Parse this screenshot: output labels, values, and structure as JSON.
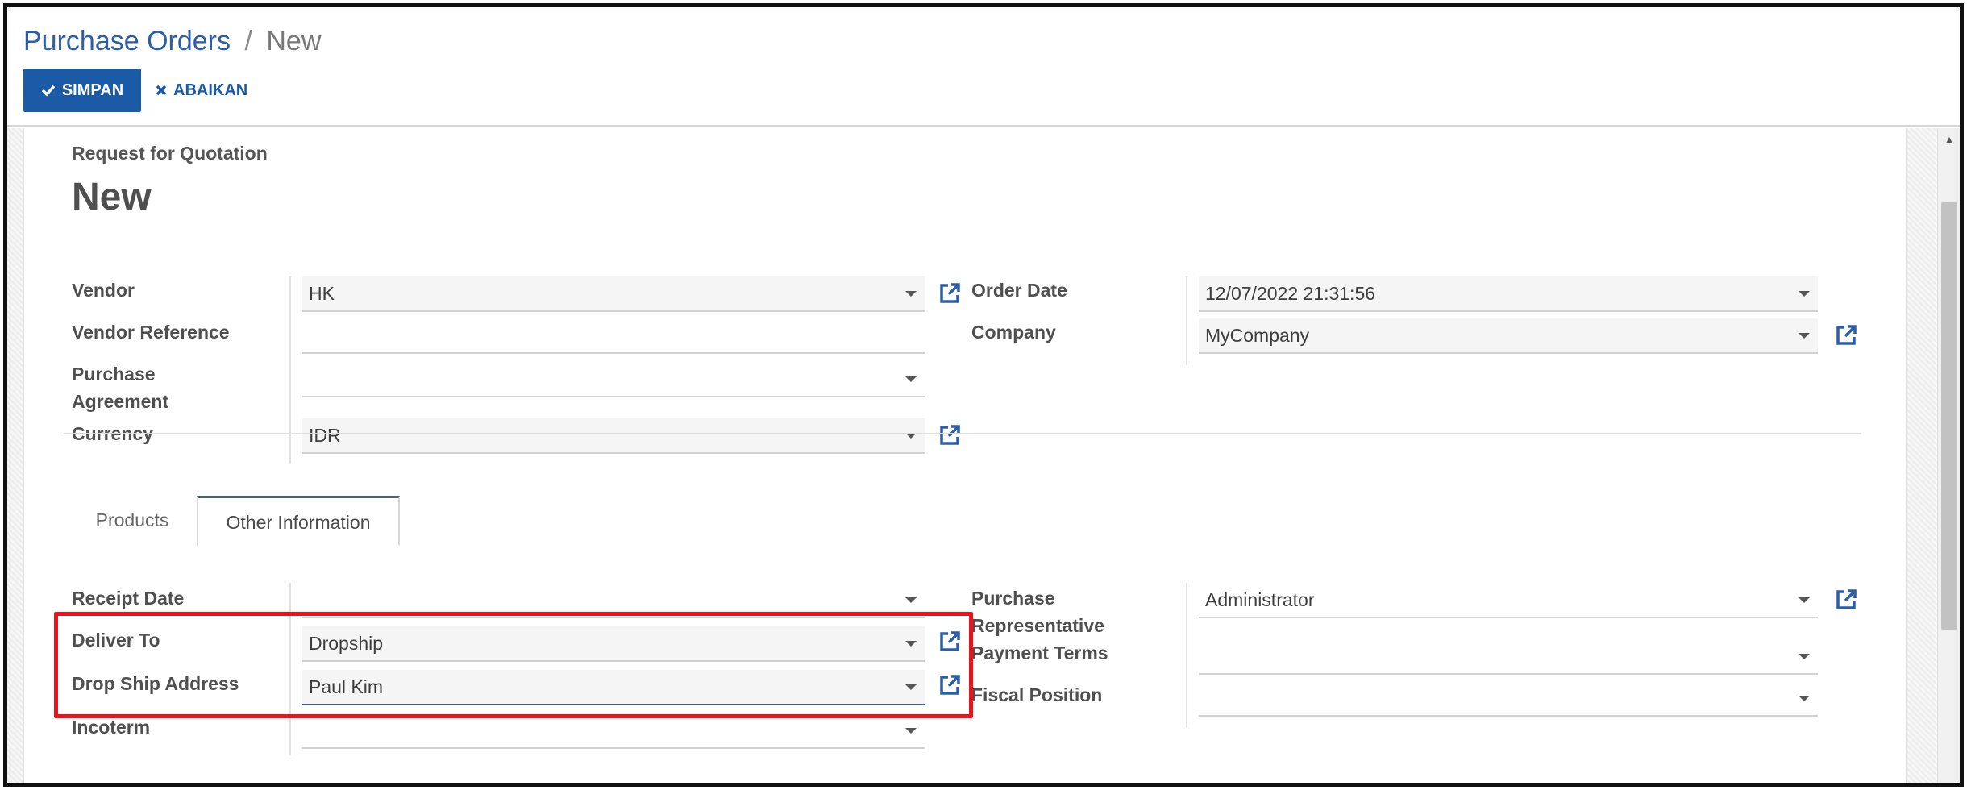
{
  "breadcrumb": {
    "parent": "Purchase Orders",
    "separator": "/",
    "current": "New"
  },
  "toolbar": {
    "save_label": "SIMPAN",
    "discard_label": "ABAIKAN"
  },
  "form": {
    "subtitle": "Request for Quotation",
    "title": "New",
    "vendor": {
      "label": "Vendor",
      "value": "HK"
    },
    "vendor_reference": {
      "label": "Vendor Reference",
      "value": ""
    },
    "purchase_agreement": {
      "label_line1": "Purchase",
      "label_line2": "Agreement",
      "value": ""
    },
    "currency": {
      "label": "Currency",
      "value": "IDR"
    },
    "order_date": {
      "label": "Order Date",
      "value": "12/07/2022 21:31:56"
    },
    "company": {
      "label": "Company",
      "value": "MyCompany"
    }
  },
  "tabs": [
    {
      "label": "Products",
      "active": false
    },
    {
      "label": "Other Information",
      "active": true
    }
  ],
  "other_info": {
    "receipt_date": {
      "label": "Receipt Date",
      "value": ""
    },
    "deliver_to": {
      "label": "Deliver To",
      "value": "Dropship"
    },
    "drop_ship_address": {
      "label": "Drop Ship Address",
      "value": "Paul Kim"
    },
    "incoterm": {
      "label": "Incoterm",
      "value": ""
    },
    "purchase_representative": {
      "label_line1": "Purchase",
      "label_line2": "Representative",
      "value": "Administrator"
    },
    "payment_terms": {
      "label": "Payment Terms",
      "value": ""
    },
    "fiscal_position": {
      "label": "Fiscal Position",
      "value": ""
    }
  },
  "colors": {
    "primary": "#1b5aa6",
    "link": "#2b5ea7",
    "highlight": "#e8141e"
  },
  "icons": [
    "check-icon",
    "close-icon",
    "external-link-icon",
    "caret-down-icon",
    "scroll-up-arrow-icon"
  ]
}
